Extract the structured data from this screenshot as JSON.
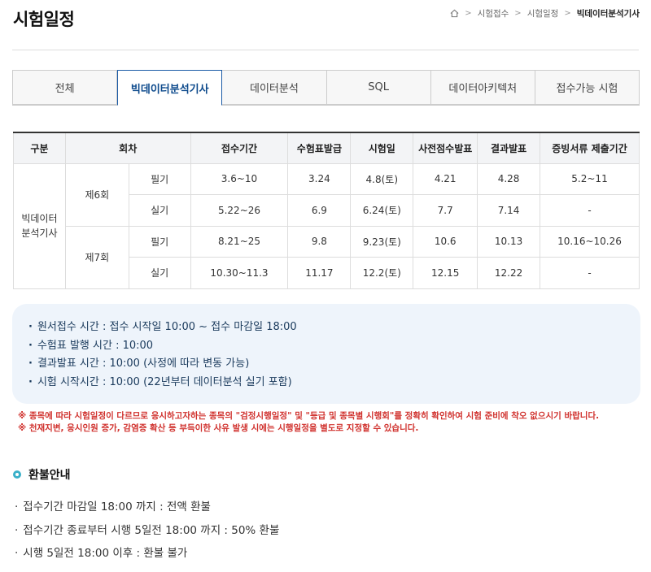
{
  "page": {
    "title": "시험일정"
  },
  "breadcrumb": {
    "items": [
      "시험접수",
      "시험일정"
    ],
    "current": "빅데이터분석기사"
  },
  "tabs": [
    {
      "label": "전체"
    },
    {
      "label": "빅데이터분석기사",
      "active": true
    },
    {
      "label": "데이터분석"
    },
    {
      "label": "SQL"
    },
    {
      "label": "데이터아키텍처"
    },
    {
      "label": "접수가능 시험"
    }
  ],
  "table": {
    "headers": [
      "구분",
      "회차",
      "접수기간",
      "수험표발급",
      "시험일",
      "사전점수발표",
      "결과발표",
      "증빙서류 제출기간"
    ],
    "category": "빅데이터\n분석기사",
    "rounds": [
      {
        "name": "제6회",
        "rows": [
          {
            "type": "필기",
            "reg": "3.6~10",
            "ticket": "3.24",
            "exam": "4.8(토)",
            "pre": "4.21",
            "result": "4.28",
            "docs": "5.2~11"
          },
          {
            "type": "실기",
            "reg": "5.22~26",
            "ticket": "6.9",
            "exam": "6.24(토)",
            "pre": "7.7",
            "result": "7.14",
            "docs": "-"
          }
        ]
      },
      {
        "name": "제7회",
        "rows": [
          {
            "type": "필기",
            "reg": "8.21~25",
            "ticket": "9.8",
            "exam": "9.23(토)",
            "pre": "10.6",
            "result": "10.13",
            "docs": "10.16~10.26"
          },
          {
            "type": "실기",
            "reg": "10.30~11.3",
            "ticket": "11.17",
            "exam": "12.2(토)",
            "pre": "12.15",
            "result": "12.22",
            "docs": "-"
          }
        ]
      }
    ]
  },
  "info": {
    "items": [
      "원서접수 시간 : 접수 시작일 10:00 ~ 접수 마감일 18:00",
      "수험표 발행 시간 : 10:00",
      "결과발표 시간 : 10:00 (사정에 따라 변동 가능)",
      "시험 시작시간 : 10:00 (22년부터 데이터분석 실기 포함)"
    ]
  },
  "notes": [
    "※ 종목에 따라 시험일정이 다르므로 응시하고자하는 종목의 \"검정시행일정\" 및 \"등급 및 종목별 시행회\"를 정확히 확인하여 시험 준비에 착오 없으시기 바랍니다.",
    "※ 천재지변, 응시인원 증가, 감염증 확산 등 부득이한 사유 발생 시에는 시행일정을 별도로 지정할 수 있습니다."
  ],
  "refund": {
    "title": "환불안내",
    "items": [
      "접수기간 마감일 18:00 까지 : 전액 환불",
      "접수기간 종료부터 시행 5일전 18:00 까지 : 50% 환불",
      "시행 5일전 18:00 이후 : 환불 불가"
    ]
  },
  "colors": {
    "accent": "#1b5ba6",
    "info_bg": "#eef4fb",
    "note_red": "#d0312d",
    "ring": "#3ab0c9"
  },
  "icons": {
    "home": "home-icon"
  }
}
